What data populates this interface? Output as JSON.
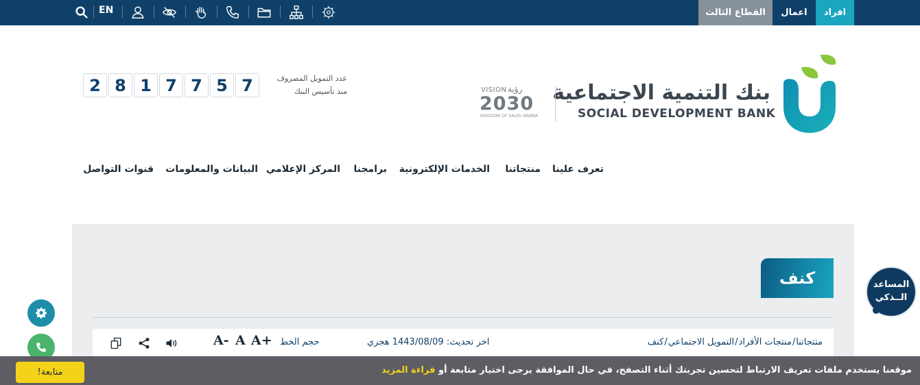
{
  "topbar": {
    "segments": [
      "افراد",
      "اعمال",
      "القطاع الثالث"
    ],
    "lang_label": "EN",
    "icons": [
      "search-icon",
      "user-icon",
      "eye-slash-icon",
      "sign-language-icon",
      "phone-icon",
      "folder-icon",
      "sitemap-icon",
      "national-emblem-icon"
    ]
  },
  "header": {
    "bank_name_ar": "بنك التنمية الاجتماعية",
    "bank_name_en": "SOCIAL DEVELOPMENT BANK",
    "vision": {
      "word": "VISION",
      "word_ar": "رؤية",
      "year": "2030",
      "country": "KINGDOM OF SAUDI ARABIA"
    },
    "counter": {
      "label_line1": "عدد التمويل المصروف",
      "label_line2": "منذ تأسيس البنك",
      "digits": [
        "2",
        "8",
        "1",
        "7",
        "7",
        "5",
        "7"
      ]
    },
    "colors": {
      "navy": "#0f4069",
      "teal": "#1aa5c0",
      "green": "#8cc63f"
    }
  },
  "nav": {
    "items": [
      "تعرف علينا",
      "منتجاتنا",
      "الخدمات الإلكترونية",
      "برامجنا",
      "المركز الإعلامي",
      "البيانات والمعلومات",
      "قنوات التواصل"
    ]
  },
  "page": {
    "title": "كنف",
    "breadcrumb": [
      "منتجاتنا",
      "منتجات الأفراد",
      "التمويل الاجتماعي",
      "كنف"
    ],
    "breadcrumb_separator": "/",
    "last_updated_label": "اخر تحديث:",
    "last_updated_value": "1443/08/09 هجري",
    "font_size_label": "حجم الخط",
    "font_buttons": [
      "A+",
      "A",
      "A-"
    ],
    "tools": [
      "speaker-icon",
      "share-icon",
      "copy-icon"
    ]
  },
  "assistant": {
    "line1": "المساعد",
    "line2": "الــذكي"
  },
  "fabs": [
    "gear-icon",
    "phone-icon"
  ],
  "cookie": {
    "text": "موقعنا يستخدم ملفات تعريف الارتباط لتحسين تجربتك أثناء التصفح، في حال الموافقة يرجى اختيار متابعة أو",
    "more_link": "قراءة المزيد",
    "button": "متابعة!"
  }
}
